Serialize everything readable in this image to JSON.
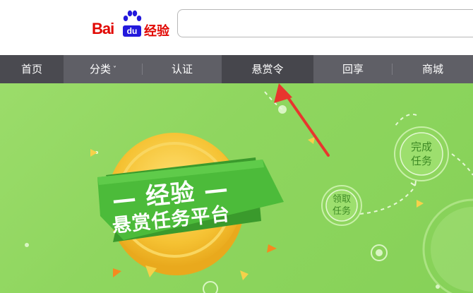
{
  "header": {
    "logo": {
      "text_bai": "Bai",
      "text_du": "du",
      "text_jingyan": "经验"
    },
    "search": {
      "value": "",
      "placeholder": ""
    }
  },
  "nav": {
    "items": [
      {
        "label": "首页"
      },
      {
        "label": "分类"
      },
      {
        "label": "认证"
      },
      {
        "label": "悬赏令"
      },
      {
        "label": "回享"
      },
      {
        "label": "商城"
      }
    ]
  },
  "banner": {
    "title": "— 经验 —",
    "subtitle": "悬赏任务平台",
    "step_receive": [
      "领取",
      "任务"
    ],
    "step_complete": [
      "完成",
      "任务"
    ]
  },
  "colors": {
    "brand_red": "#e10601",
    "brand_blue": "#2319dc",
    "nav_bg": "#5f5f66",
    "banner_green": "#8fd65f",
    "ribbon_green": "#4cbb3a",
    "coin_yellow": "#f5c233",
    "arrow_red": "#e8362e"
  }
}
